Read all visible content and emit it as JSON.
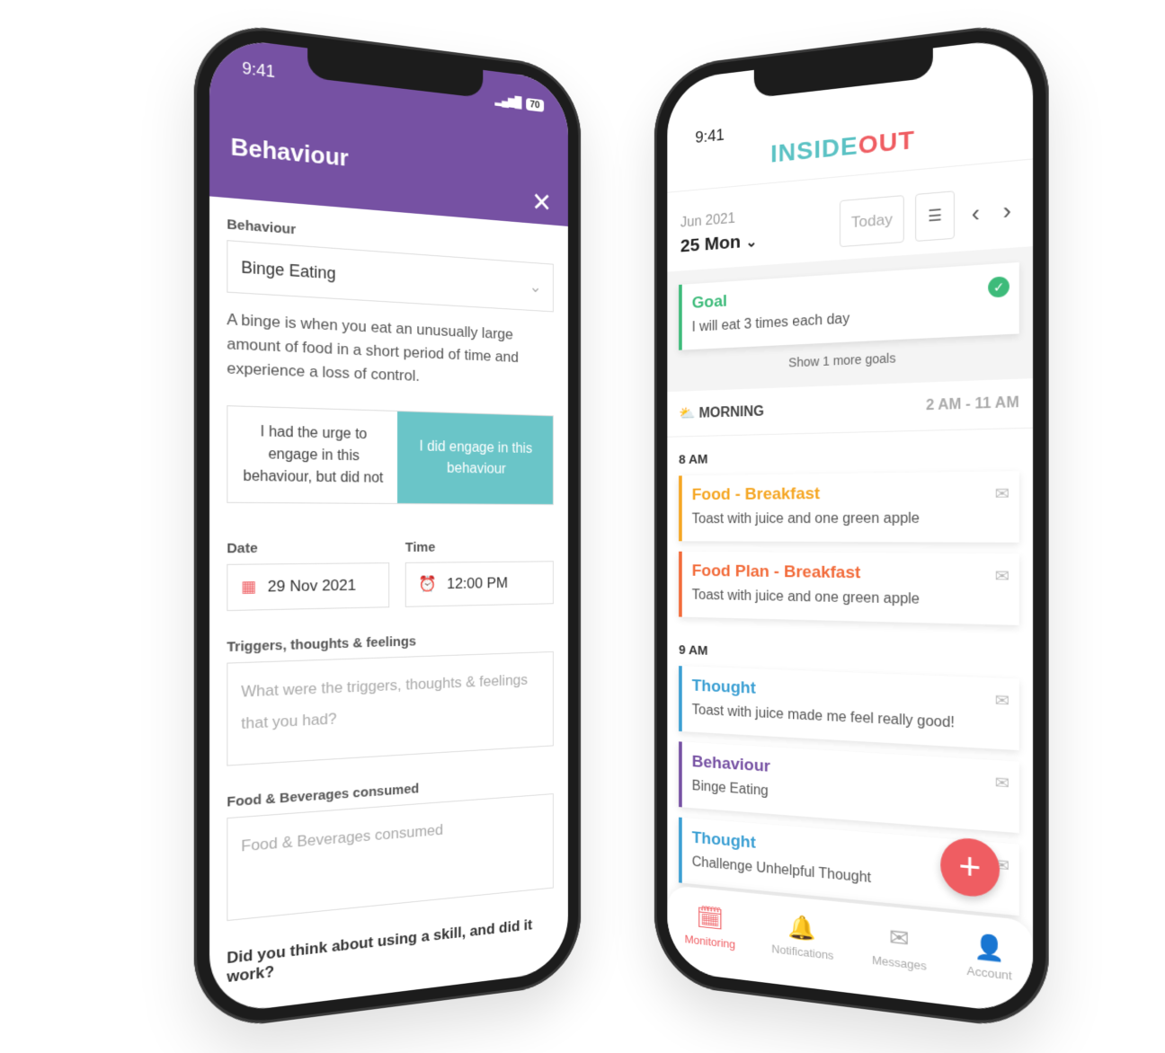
{
  "status": {
    "time": "9:41",
    "battery": "70"
  },
  "behaviour_screen": {
    "title": "Behaviour",
    "behaviour_label": "Behaviour",
    "behaviour_value": "Binge Eating",
    "description": "A binge is when you eat an unusually large amount of food in a short period of time and experience a loss of control.",
    "option_urge": "I had the urge to engage in this behaviour, but did not",
    "option_engaged": "I did engage in this behaviour",
    "date_label": "Date",
    "date_value": "29 Nov 2021",
    "time_label": "Time",
    "time_value": "12:00 PM",
    "triggers_label": "Triggers, thoughts & feelings",
    "triggers_placeholder": "What were the triggers, thoughts & feelings that you had?",
    "food_label": "Food & Beverages consumed",
    "food_placeholder": "Food & Beverages consumed",
    "skill_question": "Did you think about using a skill, and did it work?"
  },
  "monitoring_screen": {
    "logo": {
      "inside": "INSIDE",
      "out": "OUT"
    },
    "month": "Jun 2021",
    "day": "25 Mon",
    "today_button": "Today",
    "goal": {
      "title": "Goal",
      "text": "I will eat 3 times each day",
      "done": true
    },
    "show_more": "Show 1 more goals",
    "section": {
      "name": "MORNING",
      "range": "2 AM - 11 AM"
    },
    "hours": [
      "8 AM",
      "9 AM"
    ],
    "entries_8": [
      {
        "title": "Food - Breakfast",
        "text": "Toast with juice and one green apple",
        "color": "#f5a623"
      },
      {
        "title": "Food Plan - Breakfast",
        "text": "Toast with juice and one green apple",
        "color": "#f26b3a"
      }
    ],
    "entries_9": [
      {
        "title": "Thought",
        "text": "Toast with juice made me feel really good!",
        "color": "#3b9fd3"
      },
      {
        "title": "Behaviour",
        "text": "Binge Eating",
        "color": "#7651a3"
      },
      {
        "title": "Thought",
        "text": "Challenge Unhelpful Thought",
        "color": "#3b9fd3"
      }
    ],
    "tabs": [
      {
        "label": "Monitoring"
      },
      {
        "label": "Notifications"
      },
      {
        "label": "Messages"
      },
      {
        "label": "Account"
      }
    ]
  },
  "colors": {
    "purple": "#7651a3",
    "teal": "#6ac5c8",
    "coral": "#ef5d62",
    "green": "#3dbb7a"
  }
}
